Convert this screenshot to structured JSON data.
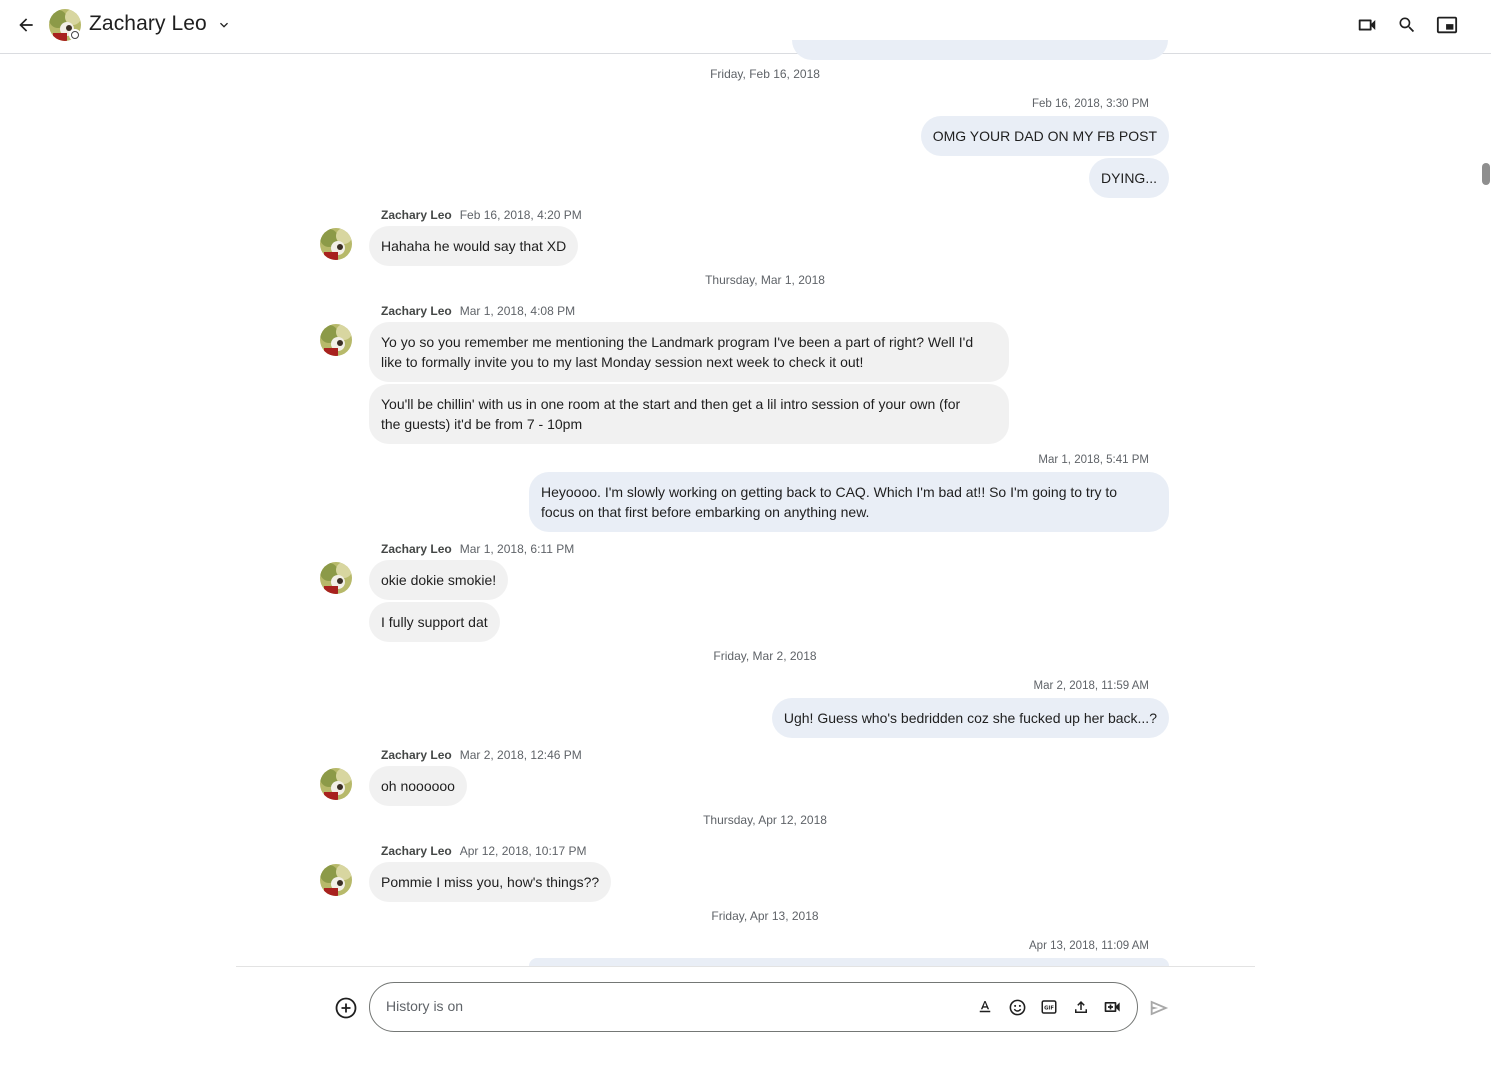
{
  "header": {
    "contact_name": "Zachary Leo",
    "icons": [
      "back-arrow-icon",
      "chevron-down-icon",
      "video-call-icon",
      "search-icon",
      "picture-in-picture-icon"
    ]
  },
  "colors": {
    "incoming_bubble": "#f1f1f1",
    "outgoing_bubble": "#e9eef6",
    "divider": "#dadce0"
  },
  "conversation": {
    "date_separators": [
      "Friday, Feb 16, 2018",
      "Thursday, Mar 1, 2018",
      "Friday, Mar 2, 2018",
      "Thursday, Apr 12, 2018",
      "Friday, Apr 13, 2018"
    ],
    "groups": [
      {
        "own_time": "Feb 16, 2018, 3:30 PM",
        "messages": [
          "OMG YOUR DAD ON MY FB POST",
          "DYING..."
        ]
      },
      {
        "sender": "Zachary Leo",
        "time": "Feb 16, 2018, 4:20 PM",
        "messages": [
          "Hahaha he would say that XD"
        ]
      },
      {
        "sender": "Zachary Leo",
        "time": "Mar 1, 2018, 4:08 PM",
        "messages": [
          "Yo yo so you remember me mentioning the Landmark program I've been a part of right? Well I'd\nlike to formally invite you to my last Monday session next week to check it out!",
          "You'll be chillin' with us in one room at the start and then get a lil intro session of your own (for\nthe guests) it'd be from 7 - 10pm"
        ]
      },
      {
        "own_time": "Mar 1, 2018, 5:41 PM",
        "messages": [
          "Heyoooo. I'm slowly working on getting back to CAQ. Which I'm bad at!! So I'm going to try to\nfocus on that first before embarking on anything new."
        ]
      },
      {
        "sender": "Zachary Leo",
        "time": "Mar 1, 2018, 6:11 PM",
        "messages": [
          "okie dokie smokie!",
          "I fully support dat"
        ]
      },
      {
        "own_time": "Mar 2, 2018, 11:59 AM",
        "messages": [
          "Ugh! Guess who's bedridden coz she fucked up her back...?"
        ]
      },
      {
        "sender": "Zachary Leo",
        "time": "Mar 2, 2018, 12:46 PM",
        "messages": [
          "oh noooooo"
        ]
      },
      {
        "sender": "Zachary Leo",
        "time": "Apr 12, 2018, 10:17 PM",
        "messages": [
          "Pommie I miss you, how's things??"
        ]
      },
      {
        "own_time": "Apr 13, 2018, 11:09 AM",
        "messages": []
      }
    ]
  },
  "composer": {
    "placeholder": "History is on",
    "icons": [
      "add-circle-icon",
      "text-format-icon",
      "emoji-icon",
      "gif-icon",
      "upload-icon",
      "video-meeting-icon",
      "send-icon"
    ]
  }
}
